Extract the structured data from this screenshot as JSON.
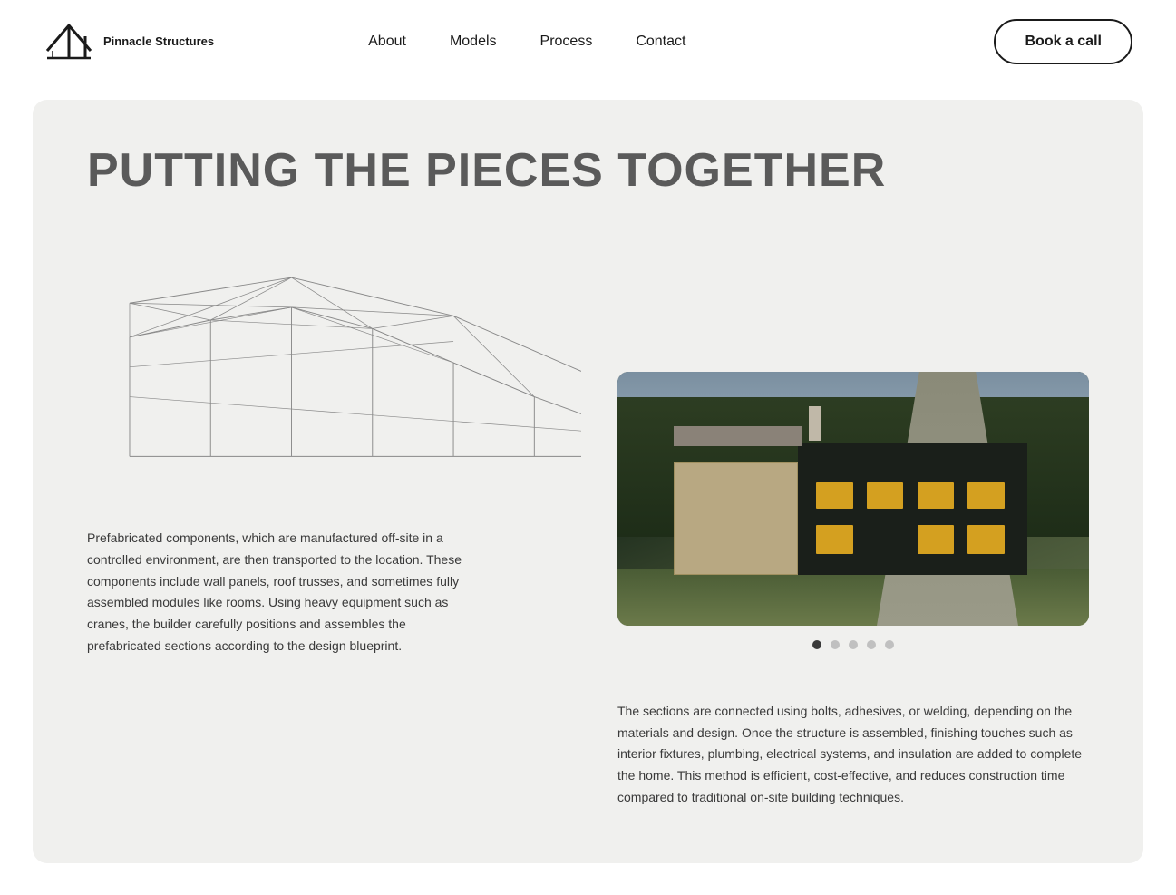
{
  "nav": {
    "logo_text": "Pinnacle\nStructures",
    "links": [
      {
        "label": "About",
        "href": "#about"
      },
      {
        "label": "Models",
        "href": "#models"
      },
      {
        "label": "Process",
        "href": "#process"
      },
      {
        "label": "Contact",
        "href": "#contact"
      }
    ],
    "cta_label": "Book a call"
  },
  "page": {
    "heading": "PUTTING THE PIECES TOGETHER",
    "description_1": "Prefabricated components, which are manufactured off-site in a controlled environment, are then transported to the location. These components include wall panels, roof trusses, and sometimes fully assembled modules like rooms. Using heavy equipment such as cranes, the builder carefully positions and assembles the prefabricated sections according to the design blueprint.",
    "description_2": "The sections are connected using bolts, adhesives, or welding, depending on the materials and design. Once the structure is assembled, finishing touches such as interior fixtures, plumbing, electrical systems, and insulation are added to complete the home. This method is efficient, cost-effective, and reduces construction time compared to traditional on-site building techniques."
  },
  "carousel": {
    "dots": [
      {
        "active": true,
        "index": 0
      },
      {
        "active": false,
        "index": 1
      },
      {
        "active": false,
        "index": 2
      },
      {
        "active": false,
        "index": 3
      },
      {
        "active": false,
        "index": 4
      }
    ]
  },
  "colors": {
    "accent": "#1a1a1a",
    "background": "#f0f0ee",
    "text": "#3a3a3a",
    "heading": "#5a5a5a"
  }
}
